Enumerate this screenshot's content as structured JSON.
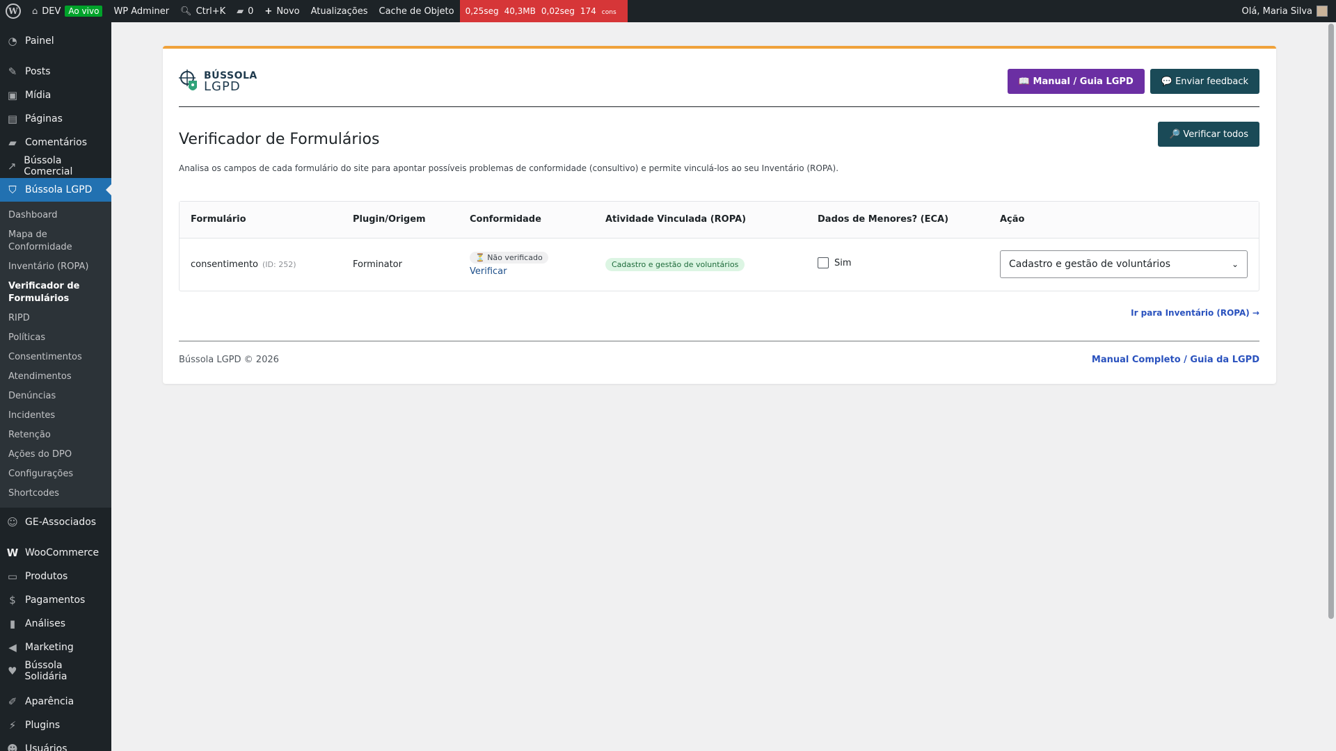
{
  "adminbar": {
    "site": "DEV",
    "live": "Ao vivo",
    "adminer": "WP Adminer",
    "search": "Ctrl+K",
    "comments_count": "0",
    "new": "Novo",
    "updates": "Atualizações",
    "cache": "Cache de Objeto",
    "qm_time": "0,25seg",
    "qm_mem": "40,3MB",
    "qm_db": "0,02seg",
    "qm_queries": "174",
    "qm_queries_unit": "cons",
    "greeting": "Olá, Maria Silva"
  },
  "sidebar": {
    "items_top": [
      {
        "label": "Painel",
        "icon": "dashboard-icon"
      }
    ],
    "items_main": [
      {
        "label": "Posts",
        "icon": "pin-icon"
      },
      {
        "label": "Mídia",
        "icon": "media-icon"
      },
      {
        "label": "Páginas",
        "icon": "pages-icon"
      },
      {
        "label": "Comentários",
        "icon": "comments-icon"
      },
      {
        "label": "Bússola Comercial",
        "icon": "chart-icon"
      },
      {
        "label": "Bússola LGPD",
        "icon": "shield-icon"
      }
    ],
    "submenu": [
      "Dashboard",
      "Mapa de Conformidade",
      "Inventário (ROPA)",
      "Verificador de Formulários",
      "RIPD",
      "Políticas",
      "Consentimentos",
      "Atendimentos",
      "Denúncias",
      "Incidentes",
      "Retenção",
      "Ações do DPO",
      "Configurações",
      "Shortcodes"
    ],
    "items_after": [
      {
        "label": "GE-Associados",
        "icon": "group-icon"
      }
    ],
    "items_commerce": [
      {
        "label": "WooCommerce",
        "icon": "woo-icon"
      },
      {
        "label": "Produtos",
        "icon": "archive-icon"
      },
      {
        "label": "Pagamentos",
        "icon": "payment-icon"
      },
      {
        "label": "Análises",
        "icon": "bar-chart-icon"
      },
      {
        "label": "Marketing",
        "icon": "megaphone-icon"
      },
      {
        "label": "Bússola Solidária",
        "icon": "heart-icon"
      }
    ],
    "items_bottom": [
      {
        "label": "Aparência",
        "icon": "brush-icon"
      },
      {
        "label": "Plugins",
        "icon": "plugin-icon"
      },
      {
        "label": "Usuários",
        "icon": "users-icon"
      }
    ]
  },
  "brand": {
    "line1": "BÚSSOLA",
    "line2": "LGPD"
  },
  "header": {
    "manual_btn": "📖 Manual / Guia LGPD",
    "feedback_btn": "💬 Enviar feedback"
  },
  "page": {
    "title": "Verificador de Formulários",
    "verify_all_btn": "🔎 Verificar todos",
    "description": "Analisa os campos de cada formulário do site para apontar possíveis problemas de conformidade (consultivo) e permite vinculá-los ao seu Inventário (ROPA)."
  },
  "table": {
    "headers": [
      "Formulário",
      "Plugin/Origem",
      "Conformidade",
      "Atividade Vinculada (ROPA)",
      "Dados de Menores? (ECA)",
      "Ação"
    ],
    "rows": [
      {
        "form": "consentimento",
        "form_id": "(ID: 252)",
        "plugin": "Forminator",
        "status": "⏳ Não verificado",
        "verify_link": "Verificar",
        "activity": "Cadastro e gestão de voluntários",
        "minors_label": "Sim",
        "action_selected": "Cadastro e gestão de voluntários"
      }
    ]
  },
  "links": {
    "ropa": "Ir para Inventário (ROPA) →"
  },
  "footer": {
    "left": "Bússola LGPD © 2026",
    "right": "Manual Completo / Guia da LGPD"
  },
  "colors": {
    "accent_top": "#f0a23b",
    "manual": "#6b2fa3",
    "primary_dark": "#1a4a57",
    "wp_active": "#2271b1"
  }
}
